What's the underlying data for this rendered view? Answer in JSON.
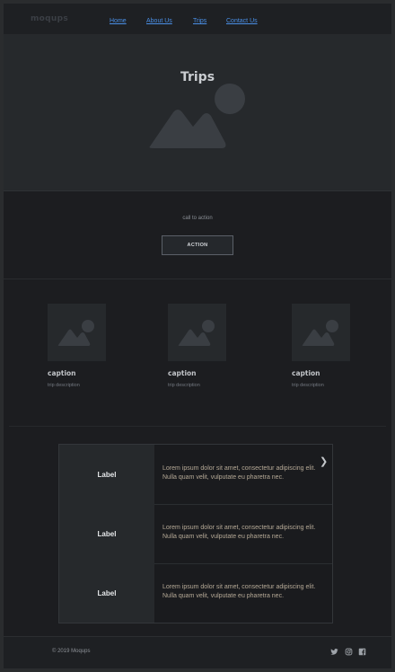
{
  "nav": {
    "logo": "moqups",
    "links": [
      "Home",
      "About Us",
      "Trips",
      "Contact Us"
    ]
  },
  "hero": {
    "title": "Trips",
    "image_icon": "image-placeholder-icon"
  },
  "cta": {
    "text": "call to action",
    "button": "ACTION"
  },
  "cards": [
    {
      "caption": "caption",
      "description": "trip description"
    },
    {
      "caption": "caption",
      "description": "trip description"
    },
    {
      "caption": "caption",
      "description": "trip description"
    }
  ],
  "accordion": {
    "items": [
      {
        "label": "Label",
        "text": "Lorem ipsum dolor sit amet, consectetur adipiscing elit. Nulla quam velit, vulputate eu pharetra nec."
      },
      {
        "label": "Label",
        "text": "Lorem ipsum dolor sit amet, consectetur adipiscing elit. Nulla quam velit, vulputate eu pharetra nec."
      },
      {
        "label": "Label",
        "text": "Lorem ipsum dolor sit amet, consectetur adipiscing elit. Nulla quam velit, vulputate eu pharetra nec."
      }
    ],
    "chevron_icon": "chevron-right-icon"
  },
  "footer": {
    "copyright": "© 2019  Moqups",
    "social_icons": [
      "twitter-icon",
      "instagram-icon",
      "facebook-icon"
    ]
  },
  "colors": {
    "background": "#1c1d20",
    "panel": "#26292c",
    "link": "#4a8fe6",
    "body_text": "#b5a996"
  }
}
